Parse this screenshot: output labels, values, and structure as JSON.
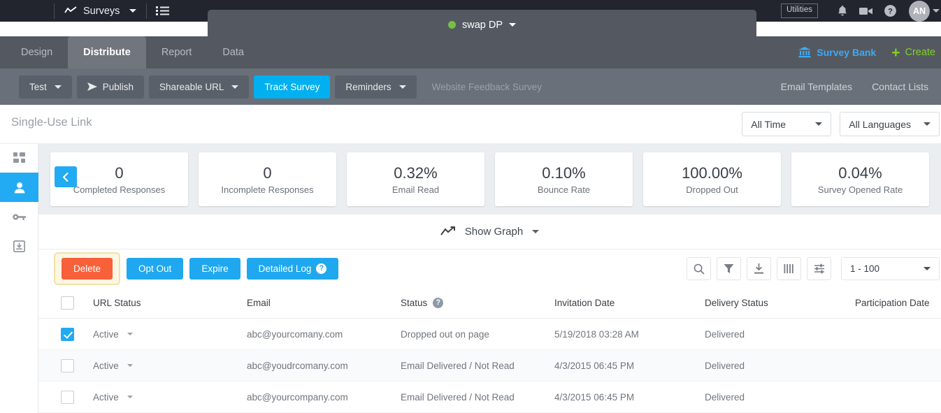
{
  "topbar": {
    "product_label": "Surveys",
    "product_icon": "trend-line-icon",
    "list_icon": "list-icon",
    "utilities_label": "Utilities",
    "bell_icon": "bell-icon",
    "video_icon": "video-camera-icon",
    "help_icon": "help-circle-icon",
    "avatar_initials": "AN"
  },
  "survey_tab": {
    "name": "swap DP",
    "status_color": "#76c043"
  },
  "nav": {
    "tabs": [
      {
        "label": "Design",
        "active": false
      },
      {
        "label": "Distribute",
        "active": true
      },
      {
        "label": "Report",
        "active": false
      },
      {
        "label": "Data",
        "active": false
      }
    ],
    "survey_bank_label": "Survey Bank",
    "survey_bank_icon": "bank-icon",
    "survey_bank_color": "#3fa9f5",
    "create_label": "Create",
    "create_color": "#7ed321"
  },
  "actionbar": {
    "buttons": [
      {
        "label": "Test",
        "type": "dropdown"
      },
      {
        "label": "Publish",
        "type": "icon",
        "icon": "send-icon"
      },
      {
        "label": "Shareable URL",
        "type": "dropdown"
      },
      {
        "label": "Track Survey",
        "type": "active"
      },
      {
        "label": "Reminders",
        "type": "dropdown"
      },
      {
        "label": "Website Feedback Survey",
        "type": "disabled"
      }
    ],
    "links": [
      "Email Templates",
      "Contact Lists"
    ]
  },
  "rail": {
    "items": [
      {
        "icon": "dashboard-grid-icon",
        "active": false
      },
      {
        "icon": "person-icon",
        "active": true
      },
      {
        "icon": "key-icon",
        "active": false
      },
      {
        "icon": "inbox-download-icon",
        "active": false
      }
    ]
  },
  "page": {
    "title": "Single-Use Link",
    "time_filter": "All Time",
    "language_filter": "All Languages",
    "collapse_icon": "chevron-left-icon"
  },
  "metrics": [
    {
      "value": "0",
      "label": "Completed Responses"
    },
    {
      "value": "0",
      "label": "Incomplete Responses"
    },
    {
      "value": "0.32%",
      "label": "Email Read"
    },
    {
      "value": "0.10%",
      "label": "Bounce Rate"
    },
    {
      "value": "100.00%",
      "label": "Dropped Out"
    },
    {
      "value": "0.04%",
      "label": "Survey Opened Rate"
    }
  ],
  "graph": {
    "label": "Show Graph",
    "icon": "trend-line-icon"
  },
  "gridbar": {
    "delete_label": "Delete",
    "opt_out_label": "Opt Out",
    "expire_label": "Expire",
    "detailed_log_label": "Detailed Log",
    "detailed_log_help": "?",
    "icons": [
      "search-icon",
      "filter-icon",
      "download-icon",
      "columns-icon",
      "settings-sliders-icon"
    ],
    "pager_label": "1 - 100"
  },
  "table": {
    "headers": [
      "URL Status",
      "Email",
      "Status",
      "Invitation Date",
      "Delivery Status",
      "Participation Date"
    ],
    "status_help": "?",
    "rows": [
      {
        "selected": true,
        "url_status": "Active",
        "email": "abc@yourcomany.com",
        "status": "Dropped out on page",
        "invitation_date": "5/19/2018 03:28 AM",
        "delivery_status": "Delivered",
        "participation_date": ""
      },
      {
        "selected": false,
        "url_status": "Active",
        "email": "abc@youdrcomany.com",
        "status": "Email Delivered / Not Read",
        "invitation_date": "4/3/2015 06:45 PM",
        "delivery_status": "Delivered",
        "participation_date": ""
      },
      {
        "selected": false,
        "url_status": "Active",
        "email": "abc@yourcompany.com",
        "status": "Email Delivered / Not Read",
        "invitation_date": "4/3/2015 06:45 PM",
        "delivery_status": "Delivered",
        "participation_date": ""
      }
    ]
  }
}
